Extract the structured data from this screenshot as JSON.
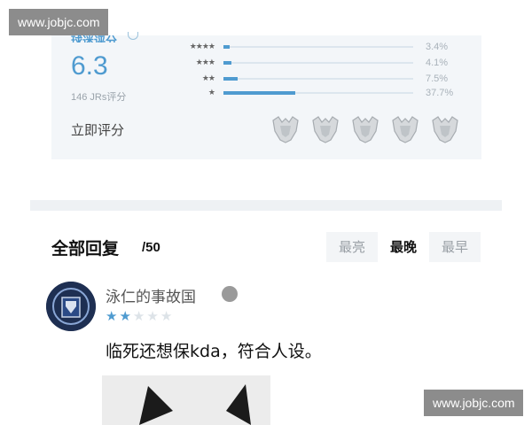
{
  "watermark": {
    "top_text": "www.jobjc.com",
    "bottom_text": "www.jobjc.com"
  },
  "rating": {
    "title": "球迷评分",
    "score": "6.3",
    "count_text": "146 JRs评分",
    "rate_now_label": "立即评分",
    "distribution": [
      {
        "stars": "★★★★",
        "percent_text": "3.4%",
        "fraction": 0.034
      },
      {
        "stars": "★★★",
        "percent_text": "4.1%",
        "fraction": 0.041
      },
      {
        "stars": "★★",
        "percent_text": "7.5%",
        "fraction": 0.075
      },
      {
        "stars": "★",
        "percent_text": "37.7%",
        "fraction": 0.377
      }
    ],
    "rating_emblem_icon": "trophy-emblem-icon",
    "emblem_count": 5
  },
  "replies": {
    "title": "全部回复",
    "count": "/50",
    "sort_tabs": [
      {
        "label": "最亮",
        "active": false
      },
      {
        "label": "最晚",
        "active": true
      },
      {
        "label": "最早",
        "active": false
      }
    ]
  },
  "comment": {
    "username": "泳仁的事故国",
    "avatar_icon": "team-logo-avatar",
    "rating_filled": 2,
    "rating_total": 5,
    "text": "临死还想保kda，符合人设。"
  },
  "colors": {
    "accent": "#4f9bd0",
    "star_on": "#4f9bd0",
    "star_off": "#dde3e8",
    "band": "#eef1f4"
  }
}
